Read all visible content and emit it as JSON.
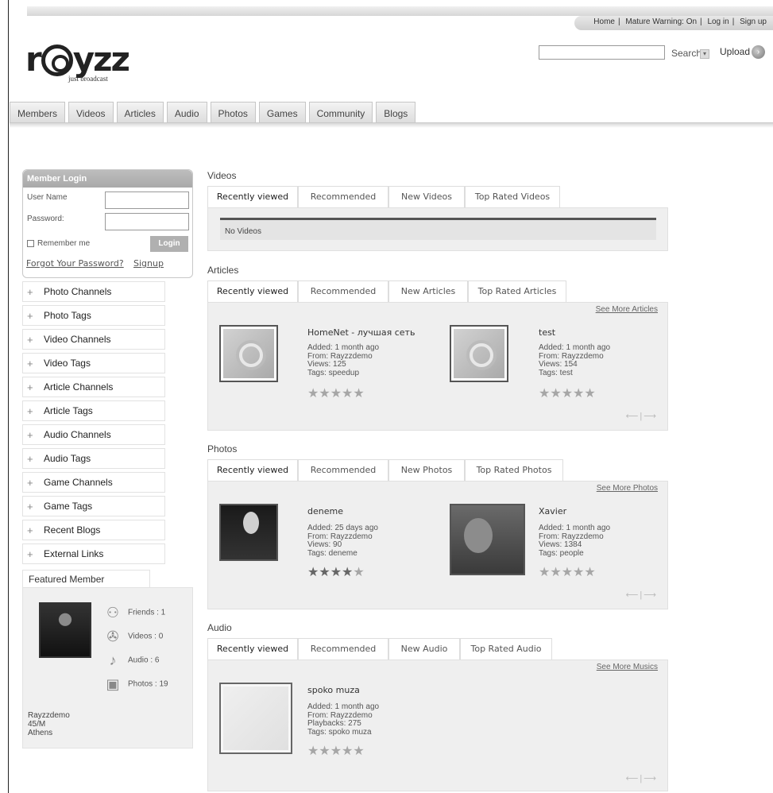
{
  "header": {
    "top_links": [
      "Home",
      "Mature Warning: On",
      "Log in",
      "Sign up"
    ],
    "logo_text": "r@yzz",
    "logo_tagline": "just broadcast",
    "search_label": "Search",
    "upload_label": "Upload"
  },
  "nav": {
    "tabs": [
      "Members",
      "Videos",
      "Articles",
      "Audio",
      "Photos",
      "Games",
      "Community",
      "Blogs"
    ]
  },
  "login": {
    "title": "Member Login",
    "username_label": "User Name",
    "password_label": "Password:",
    "remember_label": "Remember me",
    "login_button": "Login",
    "forgot_link": "Forgot Your Password?",
    "signup_link": "Signup"
  },
  "sidebar": {
    "items": [
      "Photo Channels",
      "Photo Tags",
      "Video Channels",
      "Video Tags",
      "Article Channels",
      "Article Tags",
      "Audio Channels",
      "Audio Tags",
      "Game Channels",
      "Game Tags",
      "Recent Blogs",
      "External Links"
    ]
  },
  "featured": {
    "title": "Featured Member",
    "friends": "Friends : 1",
    "videos": "Videos : 0",
    "audio": "Audio : 6",
    "photos": "Photos : 19",
    "name": "Rayzzdemo",
    "age_sex": "45/M",
    "city": "Athens"
  },
  "videos": {
    "title": "Videos",
    "tabs": [
      "Recently viewed",
      "Recommended",
      "New Videos",
      "Top Rated Videos"
    ],
    "empty": "No Videos"
  },
  "articles": {
    "title": "Articles",
    "tabs": [
      "Recently viewed",
      "Recommended",
      "New Articles",
      "Top Rated Articles"
    ],
    "see_more": "See More Articles",
    "items": [
      {
        "title": "HomeNet - лучшая сеть",
        "added": "Added: 1 month ago",
        "from": "From:  Rayzzdemo",
        "views": "Views: 125",
        "tags": "Tags: speedup",
        "rating": 0
      },
      {
        "title": "test",
        "added": "Added: 1 month ago",
        "from": "From:  Rayzzdemo",
        "views": "Views: 154",
        "tags": "Tags: test",
        "rating": 0
      }
    ]
  },
  "photos": {
    "title": "Photos",
    "tabs": [
      "Recently viewed",
      "Recommended",
      "New Photos",
      "Top Rated Photos"
    ],
    "see_more": "See More Photos",
    "items": [
      {
        "title": "deneme",
        "added": "Added: 25 days ago",
        "from": "From:  Rayzzdemo",
        "views": "Views: 90",
        "tags": "Tags: deneme",
        "rating": 4
      },
      {
        "title": "Xavier",
        "added": "Added: 1 month ago",
        "from": "From:  Rayzzdemo",
        "views": "Views: 1384",
        "tags": "Tags: people",
        "rating": 0
      }
    ]
  },
  "audio": {
    "title": "Audio",
    "tabs": [
      "Recently viewed",
      "Recommended",
      "New Audio",
      "Top Rated Audio"
    ],
    "see_more": "See More Musics",
    "items": [
      {
        "title": "spoko muza",
        "added": "Added: 1 month ago",
        "from": "From:  Rayzzdemo",
        "plays": "Playbacks: 275",
        "tags": "Tags: spoko muza",
        "rating": 0
      }
    ]
  },
  "pager": {
    "prev": "⟵",
    "next": "⟶"
  }
}
